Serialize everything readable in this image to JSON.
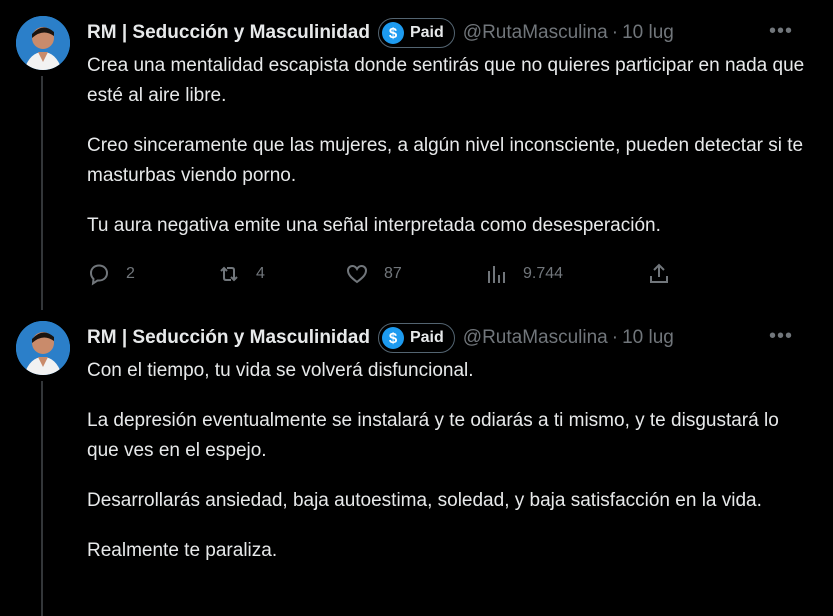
{
  "tweets": [
    {
      "author_name": "RM | Seducción y Masculinidad",
      "paid_label": "Paid",
      "paid_symbol": "$",
      "handle": "@RutaMasculina",
      "separator": "·",
      "date": "10 lug",
      "more_icon": "more-horizontal-icon",
      "paragraphs": [
        "Crea una mentalidad escapista donde sentirás que no quieres participar en nada que esté al aire libre.",
        "Creo sinceramente que las mujeres, a algún nivel inconsciente, pueden detectar si te masturbas viendo porno.",
        "Tu aura negativa emite una señal interpretada como desesperación."
      ],
      "actions": {
        "replies": "2",
        "retweets": "4",
        "likes": "87",
        "views": "9.744"
      }
    },
    {
      "author_name": "RM | Seducción y Masculinidad",
      "paid_label": "Paid",
      "paid_symbol": "$",
      "handle": "@RutaMasculina",
      "separator": "·",
      "date": "10 lug",
      "more_icon": "more-horizontal-icon",
      "paragraphs": [
        "Con el tiempo, tu vida se volverá disfuncional.",
        "La depresión eventualmente se instalará y te odiarás a ti mismo, y te disgustará lo que ves en el espejo.",
        "Desarrollarás ansiedad, baja autoestima, soledad, y baja satisfacción en la vida.",
        "Realmente te paraliza."
      ]
    }
  ],
  "colors": {
    "background": "#000000",
    "text": "#e7e9ea",
    "muted": "#71767b",
    "accent": "#1d9bf0"
  }
}
